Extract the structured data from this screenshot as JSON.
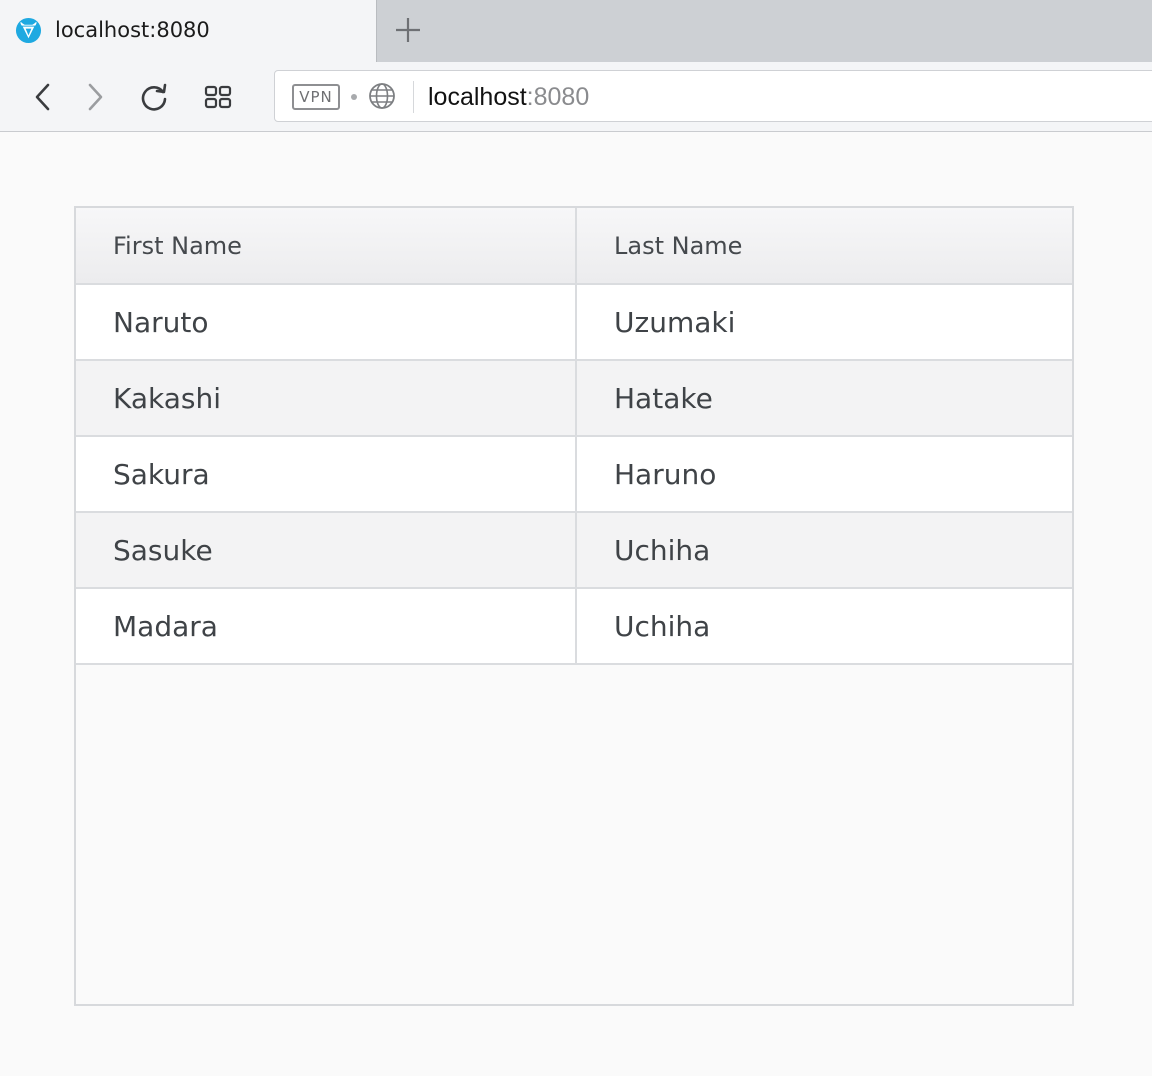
{
  "browser": {
    "tab_title": "localhost:8080",
    "favicon": "vivaldi-logo-icon",
    "new_tab_icon": "plus-icon",
    "nav": {
      "back_icon": "chevron-left-icon",
      "forward_icon": "chevron-right-icon",
      "reload_icon": "reload-icon",
      "tabs_icon": "grid-icon"
    },
    "vpn_label": "VPN",
    "url_host": "localhost",
    "url_port": ":8080"
  },
  "grid": {
    "columns": [
      "First Name",
      "Last Name"
    ],
    "rows": [
      [
        "Naruto",
        "Uzumaki"
      ],
      [
        "Kakashi",
        "Hatake"
      ],
      [
        "Sakura",
        "Haruno"
      ],
      [
        "Sasuke",
        "Uchiha"
      ],
      [
        "Madara",
        "Uchiha"
      ]
    ]
  }
}
